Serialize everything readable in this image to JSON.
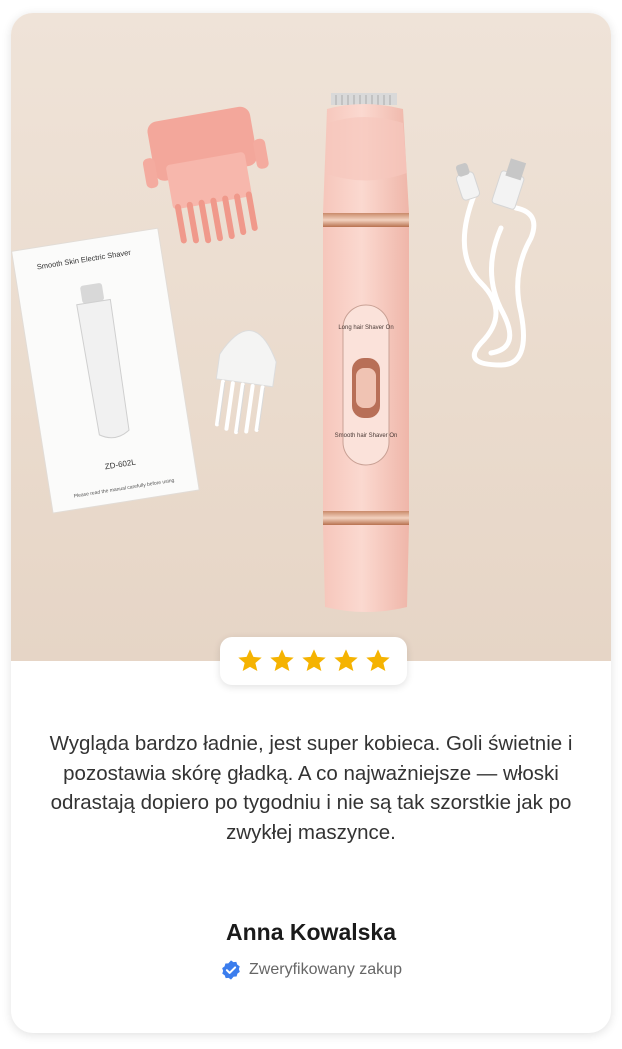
{
  "product_image": {
    "manual_title": "Smooth Skin Electric Shaver",
    "manual_model": "ZD-602L",
    "manual_footer": "Please read the manual carefully before using",
    "shaver_switch_top": "Long hair Shaver On",
    "shaver_switch_bottom": "Smooth hair Shaver On"
  },
  "rating": {
    "stars": 5,
    "max": 5,
    "color": "#f5b301"
  },
  "review": {
    "text": "Wygląda bardzo ładnie, jest super kobieca. Goli świetnie i pozostawia skórę gładką. A co najważniejsze — włoski odrastają dopiero po tygodniu i nie są tak szorstkie jak po zwykłej maszynce.",
    "author": "Anna Kowalska",
    "verified_label": "Zweryfikowany zakup",
    "verified_icon": "verified-badge-icon",
    "verified_color": "#3b7ded"
  }
}
